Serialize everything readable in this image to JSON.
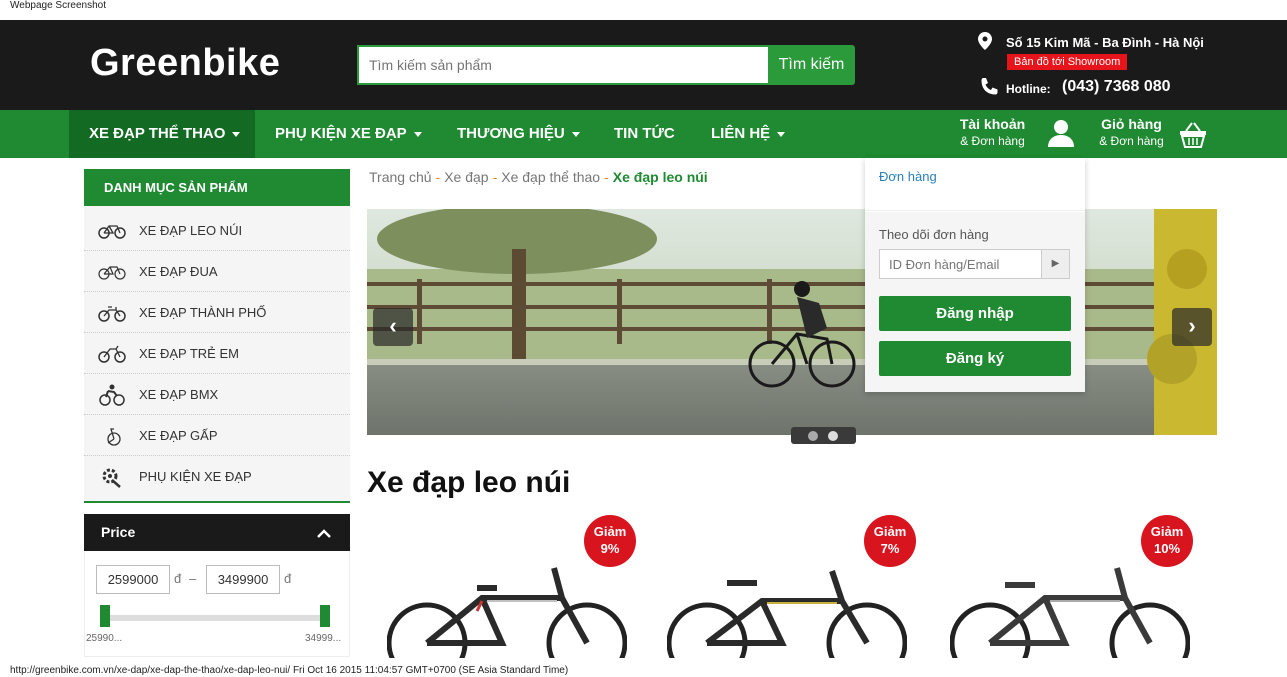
{
  "caption": "Webpage Screenshot",
  "header": {
    "logo": "Greenbike",
    "search_placeholder": "Tìm kiếm sản phẩm",
    "search_button": "Tìm kiếm",
    "address": "Số 15 Kim Mã - Ba Đình - Hà Nội",
    "map_link": "Bản đồ tới Showroom",
    "hotline_label": "Hotline:",
    "hotline_number": "(043) 7368 080"
  },
  "nav": {
    "items": [
      {
        "label": "XE ĐẠP THỂ THAO"
      },
      {
        "label": "PHỤ KIỆN XE ĐẠP"
      },
      {
        "label": "THƯƠNG HIỆU"
      },
      {
        "label": "TIN TỨC"
      },
      {
        "label": "LIÊN HỆ"
      }
    ],
    "account": {
      "line1": "Tài khoản",
      "line2": "& Đơn hàng"
    },
    "cart": {
      "line1": "Giỏ hàng",
      "line2": "& Đơn hàng"
    }
  },
  "sidebar": {
    "title": "DANH MỤC SẢN PHẨM",
    "categories": [
      {
        "label": "XE ĐẠP LEO NÚI",
        "icon": "mountain-bike-icon"
      },
      {
        "label": "XE ĐẠP ĐUA",
        "icon": "road-bike-icon"
      },
      {
        "label": "XE ĐẠP THÀNH PHỐ",
        "icon": "city-bike-icon"
      },
      {
        "label": "XE ĐẠP TRẺ EM",
        "icon": "kids-bike-icon"
      },
      {
        "label": "XE ĐẠP BMX",
        "icon": "bmx-icon"
      },
      {
        "label": "XE ĐẠP GẤP",
        "icon": "folding-bike-icon"
      },
      {
        "label": "PHỤ KIỆN XE ĐẠP",
        "icon": "gear-icon"
      }
    ]
  },
  "price_filter": {
    "title": "Price",
    "min": "2599000",
    "max": "3499900",
    "currency": "đ",
    "dash": "–",
    "min_label": "25990...",
    "max_label": "34999..."
  },
  "breadcrumb": {
    "items": [
      "Trang chủ",
      "Xe đạp",
      "Xe đạp thể thao"
    ],
    "current": "Xe đạp leo núi",
    "separator": "-"
  },
  "dropdown": {
    "orders": "Đơn hàng",
    "track_label": "Theo dõi đơn hàng",
    "track_placeholder": "ID Đơn hàng/Email",
    "login": "Đăng nhập",
    "register": "Đăng ký"
  },
  "section_title": "Xe đạp leo núi",
  "products": [
    {
      "discount_label": "Giảm",
      "discount": "9%"
    },
    {
      "discount_label": "Giảm",
      "discount": "7%"
    },
    {
      "discount_label": "Giảm",
      "discount": "10%"
    }
  ],
  "footer_url": "http://greenbike.com.vn/xe-dap/xe-dap-the-thao/xe-dap-leo-nui/ Fri Oct 16 2015 11:04:57 GMT+0700 (SE Asia Standard Time)"
}
